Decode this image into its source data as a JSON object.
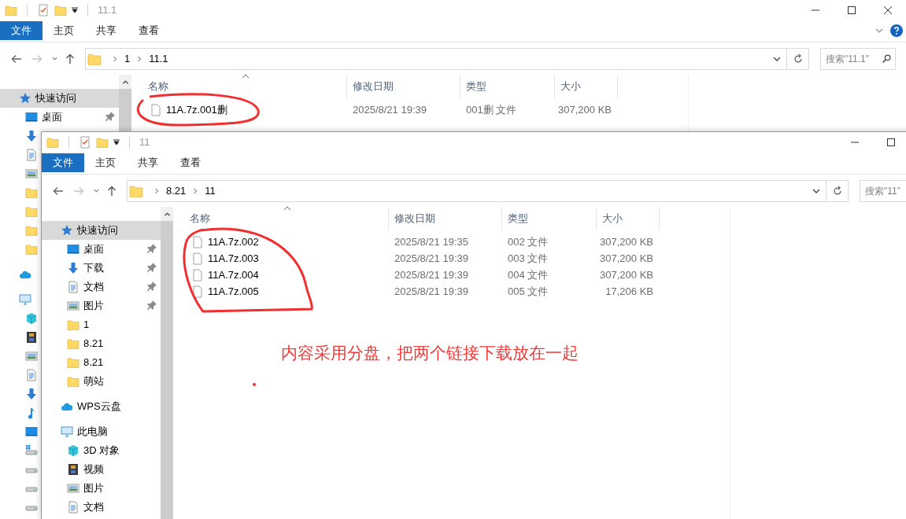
{
  "windows": [
    {
      "title": "11.1",
      "controls": [
        {
          "kind": "minimize"
        },
        {
          "kind": "maximize"
        },
        {
          "kind": "close"
        }
      ],
      "ribbon_help": true,
      "ribbon_tabs": [
        {
          "label": "文件",
          "selected": true
        },
        {
          "label": "主页",
          "selected": false
        },
        {
          "label": "共享",
          "selected": false
        },
        {
          "label": "查看",
          "selected": false
        }
      ],
      "path": [
        "1",
        "11.1"
      ],
      "search": {
        "placeholder": "搜索\"11.1\""
      },
      "nav": [
        {
          "kind": "star",
          "label": "快速访问",
          "selected": true,
          "children": [
            {
              "kind": "desktop",
              "label": "桌面",
              "pinned": true,
              "selected": false
            },
            {
              "kind": "download",
              "selected": false
            },
            {
              "kind": "document",
              "selected": false
            },
            {
              "kind": "image",
              "selected": false
            },
            {
              "kind": "folder",
              "selected": false
            },
            {
              "kind": "folder",
              "selected": false
            },
            {
              "kind": "folder",
              "selected": false
            },
            {
              "kind": "folder",
              "selected": false
            }
          ]
        },
        {
          "kind": "cloud",
          "selected": false
        },
        {
          "kind": "computer",
          "selected": false,
          "children": [
            {
              "kind": "cube",
              "selected": false
            },
            {
              "kind": "film",
              "selected": false
            },
            {
              "kind": "image",
              "selected": false
            },
            {
              "kind": "document",
              "selected": false
            },
            {
              "kind": "download",
              "selected": false
            },
            {
              "kind": "music",
              "selected": false
            },
            {
              "kind": "desktop",
              "selected": false
            },
            {
              "kind": "drive-windows",
              "selected": false
            },
            {
              "kind": "drive",
              "selected": false
            },
            {
              "kind": "drive",
              "selected": false
            },
            {
              "kind": "drive",
              "selected": false
            }
          ]
        }
      ],
      "columns": [
        "名称",
        "修改日期",
        "类型",
        "大小"
      ],
      "files": [
        {
          "name": "11A.7z.001删",
          "modified": "2025/8/21 19:39",
          "type": "001删 文件",
          "size": "307,200 KB",
          "selected": false
        }
      ]
    },
    {
      "title": "11",
      "controls": [
        {
          "kind": "minimize"
        },
        {
          "kind": "maximize"
        }
      ],
      "ribbon_help": false,
      "ribbon_tabs": [
        {
          "label": "文件",
          "selected": true
        },
        {
          "label": "主页",
          "selected": false
        },
        {
          "label": "共享",
          "selected": false
        },
        {
          "label": "查看",
          "selected": false
        }
      ],
      "path": [
        "8.21",
        "11"
      ],
      "search": {
        "placeholder": "搜索\"11\""
      },
      "nav": [
        {
          "kind": "star",
          "label": "快速访问",
          "selected": true,
          "children": [
            {
              "kind": "desktop",
              "label": "桌面",
              "pinned": true,
              "selected": false
            },
            {
              "kind": "download",
              "label": "下载",
              "pinned": true,
              "selected": false
            },
            {
              "kind": "document",
              "label": "文档",
              "pinned": true,
              "selected": false
            },
            {
              "kind": "image",
              "label": "图片",
              "pinned": true,
              "selected": false
            },
            {
              "kind": "folder",
              "label": "1",
              "pinned": false,
              "selected": false
            },
            {
              "kind": "folder",
              "label": "8.21",
              "pinned": false,
              "selected": false
            },
            {
              "kind": "folder",
              "label": "8.21",
              "pinned": false,
              "selected": false
            },
            {
              "kind": "folder",
              "label": "萌站",
              "pinned": false,
              "selected": false
            }
          ]
        },
        {
          "kind": "cloud",
          "label": "WPS云盘",
          "selected": false
        },
        {
          "kind": "computer",
          "label": "此电脑",
          "selected": false,
          "children": [
            {
              "kind": "cube",
              "label": "3D 对象",
              "selected": false
            },
            {
              "kind": "film",
              "label": "视频",
              "selected": false
            },
            {
              "kind": "image",
              "label": "图片",
              "selected": false
            },
            {
              "kind": "document",
              "label": "文档",
              "selected": false
            }
          ]
        }
      ],
      "columns": [
        "名称",
        "修改日期",
        "类型",
        "大小"
      ],
      "files": [
        {
          "name": "11A.7z.002",
          "modified": "2025/8/21 19:35",
          "type": "002 文件",
          "size": "307,200 KB",
          "selected": false
        },
        {
          "name": "11A.7z.003",
          "modified": "2025/8/21 19:39",
          "type": "003 文件",
          "size": "307,200 KB",
          "selected": false
        },
        {
          "name": "11A.7z.004",
          "modified": "2025/8/21 19:39",
          "type": "004 文件",
          "size": "307,200 KB",
          "selected": false
        },
        {
          "name": "11A.7z.005",
          "modified": "2025/8/21 19:39",
          "type": "005 文件",
          "size": "17,206 KB",
          "selected": false
        }
      ]
    }
  ],
  "annotation": {
    "note": "内容采用分盘，把两个链接下载放在一起"
  }
}
